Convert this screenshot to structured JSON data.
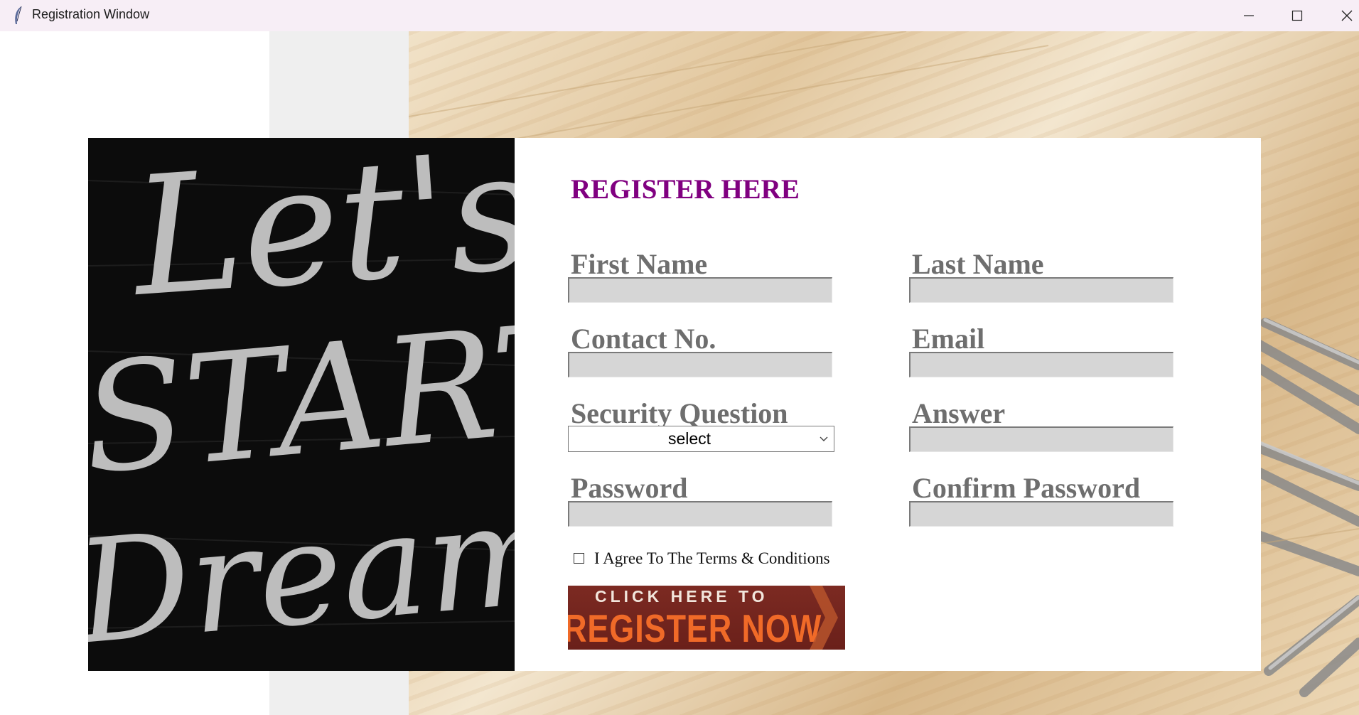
{
  "window": {
    "title": "Registration Window",
    "icons": {
      "app": "feather-icon",
      "minimize": "minimize-icon",
      "maximize": "maximize-icon",
      "close": "close-icon"
    }
  },
  "banner": {
    "text": "Let's START Dreaming"
  },
  "form": {
    "heading": "REGISTER HERE",
    "first_name": {
      "label": "First Name",
      "value": ""
    },
    "last_name": {
      "label": "Last Name",
      "value": ""
    },
    "contact": {
      "label": "Contact No.",
      "value": ""
    },
    "email": {
      "label": "Email",
      "value": ""
    },
    "security_question": {
      "label": "Security Question",
      "selected": "select"
    },
    "answer": {
      "label": "Answer",
      "value": ""
    },
    "password": {
      "label": "Password",
      "value": ""
    },
    "confirm_password": {
      "label": "Confirm Password",
      "value": ""
    },
    "terms": {
      "label": "I Agree To The Terms & Conditions",
      "checked": false
    },
    "register_button": {
      "line1": "CLICK HERE TO",
      "line2": "REGISTER NOW"
    }
  },
  "colors": {
    "heading": "#800080",
    "label": "#6e6e6e",
    "field": "#d6d6d6",
    "button_bg": "#6a201a",
    "button_text": "#f06a28"
  }
}
